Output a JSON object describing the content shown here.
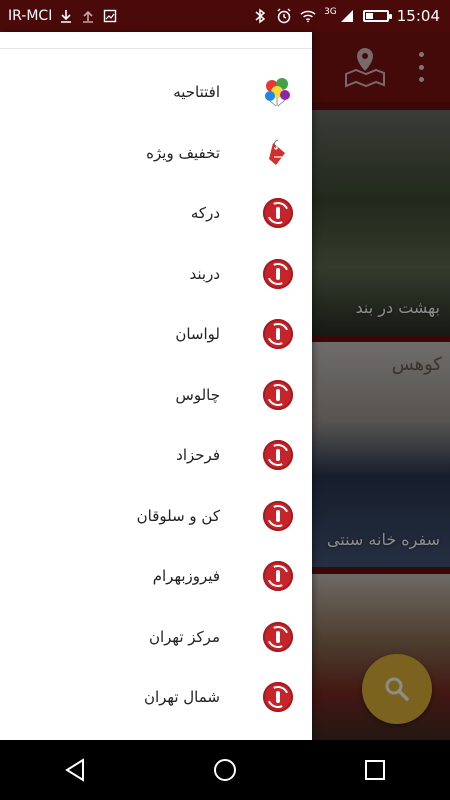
{
  "status_bar": {
    "carrier": "IR-MCI",
    "network_type": "3G",
    "time": "15:04",
    "battery_level": 0.4,
    "icons": [
      "download-icon",
      "upload-icon",
      "screenshot-icon",
      "bluetooth-icon",
      "alarm-icon",
      "wifi-icon",
      "signal-icon",
      "battery-icon"
    ]
  },
  "drawer": {
    "items": [
      {
        "label": "افتتاحیه",
        "icon": "balloons-icon"
      },
      {
        "label": "تخفیف ویژه",
        "icon": "discount-tag-icon"
      },
      {
        "label": "درکه",
        "icon": "place-icon"
      },
      {
        "label": "دربند",
        "icon": "place-icon"
      },
      {
        "label": "لواسان",
        "icon": "place-icon"
      },
      {
        "label": "چالوس",
        "icon": "place-icon"
      },
      {
        "label": "فرحزاد",
        "icon": "place-icon"
      },
      {
        "label": "کن و سلوقان",
        "icon": "place-icon"
      },
      {
        "label": "فیروزبهرام",
        "icon": "place-icon"
      },
      {
        "label": "مرکز تهران",
        "icon": "place-icon"
      },
      {
        "label": "شمال تهران",
        "icon": "place-icon"
      }
    ]
  },
  "background": {
    "cards": [
      {
        "title": "بهشت در بند"
      },
      {
        "title": "سفره خانه سنتی",
        "logo": "کوهس"
      },
      {
        "title": ""
      }
    ]
  },
  "colors": {
    "status_bar": "#4b0a0a",
    "app_bar": "#7d1112",
    "accent_red": "#c5252a",
    "fab": "#e0b43a"
  }
}
